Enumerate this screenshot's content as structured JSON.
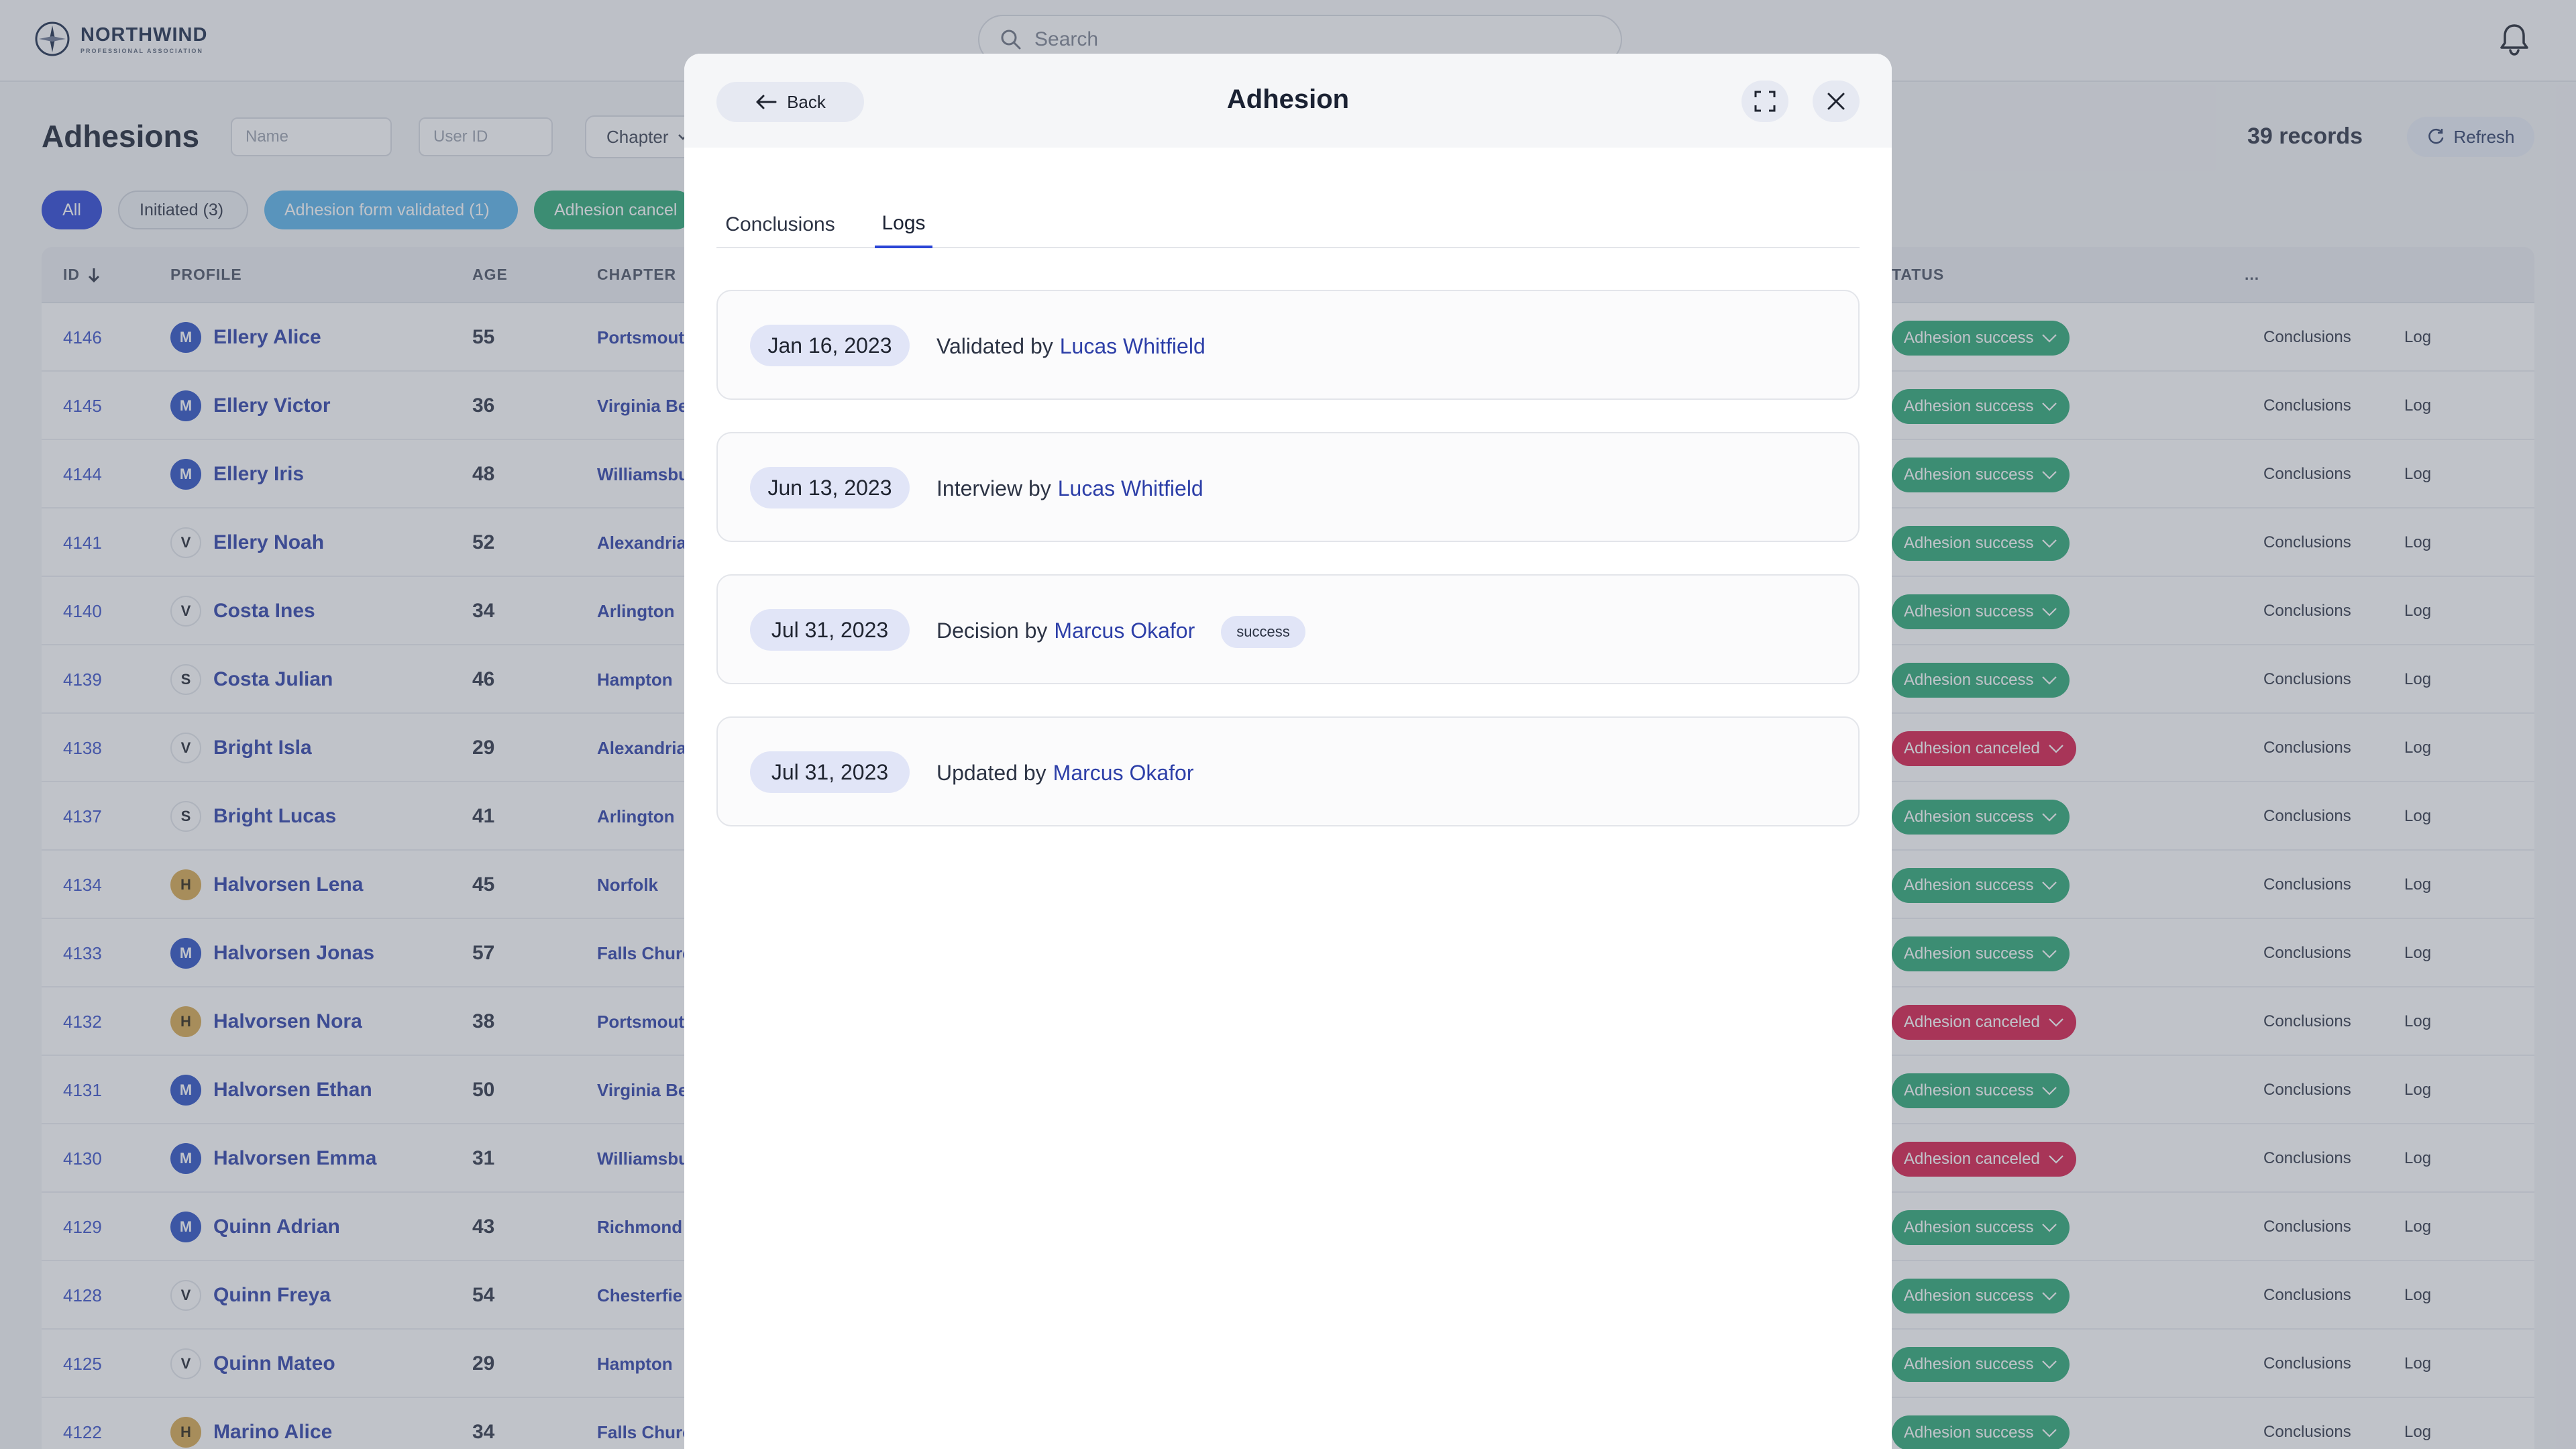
{
  "app": {
    "logo_name": "NORTHWIND",
    "logo_sub": "PROFESSIONAL ASSOCIATION",
    "search_placeholder": "Search"
  },
  "toolbar": {
    "title": "Adhesions",
    "name_placeholder": "Name",
    "userid_placeholder": "User ID",
    "chapter_label": "Chapter",
    "records": "39 records",
    "refresh_label": "Refresh"
  },
  "chips": {
    "all": "All",
    "initiated": "Initiated (3)",
    "validated": "Adhesion form validated (1)",
    "canceled": "Adhesion cancel"
  },
  "table": {
    "headers": {
      "id": "ID",
      "profile": "PROFILE",
      "age": "AGE",
      "chapter": "CHAPTER",
      "status": "TATUS",
      "more": "..."
    },
    "rows": [
      {
        "id": "4146",
        "initial": "M",
        "name": "Ellery Alice",
        "age": "55",
        "chapter": "Portsmout",
        "status": "Adhesion success",
        "status_kind": "success"
      },
      {
        "id": "4145",
        "initial": "M",
        "name": "Ellery Victor",
        "age": "36",
        "chapter": "Virginia Be",
        "status": "Adhesion success",
        "status_kind": "success"
      },
      {
        "id": "4144",
        "initial": "M",
        "name": "Ellery Iris",
        "age": "48",
        "chapter": "Williamsbu",
        "status": "Adhesion success",
        "status_kind": "success"
      },
      {
        "id": "4141",
        "initial": "V",
        "name": "Ellery Noah",
        "age": "52",
        "chapter": "Alexandria",
        "status": "Adhesion success",
        "status_kind": "success"
      },
      {
        "id": "4140",
        "initial": "V",
        "name": "Costa Ines",
        "age": "34",
        "chapter": "Arlington",
        "status": "Adhesion success",
        "status_kind": "success"
      },
      {
        "id": "4139",
        "initial": "S",
        "name": "Costa Julian",
        "age": "46",
        "chapter": "Hampton",
        "status": "Adhesion success",
        "status_kind": "success"
      },
      {
        "id": "4138",
        "initial": "V",
        "name": "Bright Isla",
        "age": "29",
        "chapter": "Alexandria",
        "status": "Adhesion canceled",
        "status_kind": "canceled"
      },
      {
        "id": "4137",
        "initial": "S",
        "name": "Bright Lucas",
        "age": "41",
        "chapter": "Arlington",
        "status": "Adhesion success",
        "status_kind": "success"
      },
      {
        "id": "4134",
        "initial": "H",
        "name": "Halvorsen Lena",
        "age": "45",
        "chapter": "Norfolk",
        "status": "Adhesion success",
        "status_kind": "success"
      },
      {
        "id": "4133",
        "initial": "M",
        "name": "Halvorsen Jonas",
        "age": "57",
        "chapter": "Falls Churc",
        "status": "Adhesion success",
        "status_kind": "success"
      },
      {
        "id": "4132",
        "initial": "H",
        "name": "Halvorsen Nora",
        "age": "38",
        "chapter": "Portsmout",
        "status": "Adhesion canceled",
        "status_kind": "canceled"
      },
      {
        "id": "4131",
        "initial": "M",
        "name": "Halvorsen Ethan",
        "age": "50",
        "chapter": "Virginia Be",
        "status": "Adhesion success",
        "status_kind": "success"
      },
      {
        "id": "4130",
        "initial": "M",
        "name": "Halvorsen Emma",
        "age": "31",
        "chapter": "Williamsbu",
        "status": "Adhesion canceled",
        "status_kind": "canceled"
      },
      {
        "id": "4129",
        "initial": "M",
        "name": "Quinn Adrian",
        "age": "43",
        "chapter": "Richmond",
        "status": "Adhesion success",
        "status_kind": "success"
      },
      {
        "id": "4128",
        "initial": "V",
        "name": "Quinn Freya",
        "age": "54",
        "chapter": "Chesterfie",
        "status": "Adhesion success",
        "status_kind": "success"
      },
      {
        "id": "4125",
        "initial": "V",
        "name": "Quinn Mateo",
        "age": "29",
        "chapter": "Hampton",
        "status": "Adhesion success",
        "status_kind": "success"
      },
      {
        "id": "4122",
        "initial": "H",
        "name": "Marino Alice",
        "age": "34",
        "chapter": "Falls Churc",
        "status": "Adhesion success",
        "status_kind": "success"
      }
    ],
    "row_conclusions_label": "Conclusions",
    "row_log_label": "Log"
  },
  "modal": {
    "title": "Adhesion",
    "back_label": "Back",
    "tabs": {
      "conclusions": "Conclusions",
      "logs": "Logs"
    },
    "active_tab": "logs",
    "logs": [
      {
        "date": "Jan 16, 2023",
        "action": "Validated by",
        "user": "Lucas Whitfield",
        "badge": ""
      },
      {
        "date": "Jun 13, 2023",
        "action": "Interview by",
        "user": "Lucas Whitfield",
        "badge": ""
      },
      {
        "date": "Jul 31, 2023",
        "action": "Decision by",
        "user": "Marcus Okafor",
        "badge": "success"
      },
      {
        "date": "Jul 31, 2023",
        "action": "Updated by",
        "user": "Marcus Okafor",
        "badge": ""
      }
    ]
  },
  "colors": {
    "primary": "#2b45d6",
    "success": "#2aa874",
    "canceled": "#d81b4a",
    "link": "#2d3fa8",
    "info": "#5ab4ea"
  }
}
